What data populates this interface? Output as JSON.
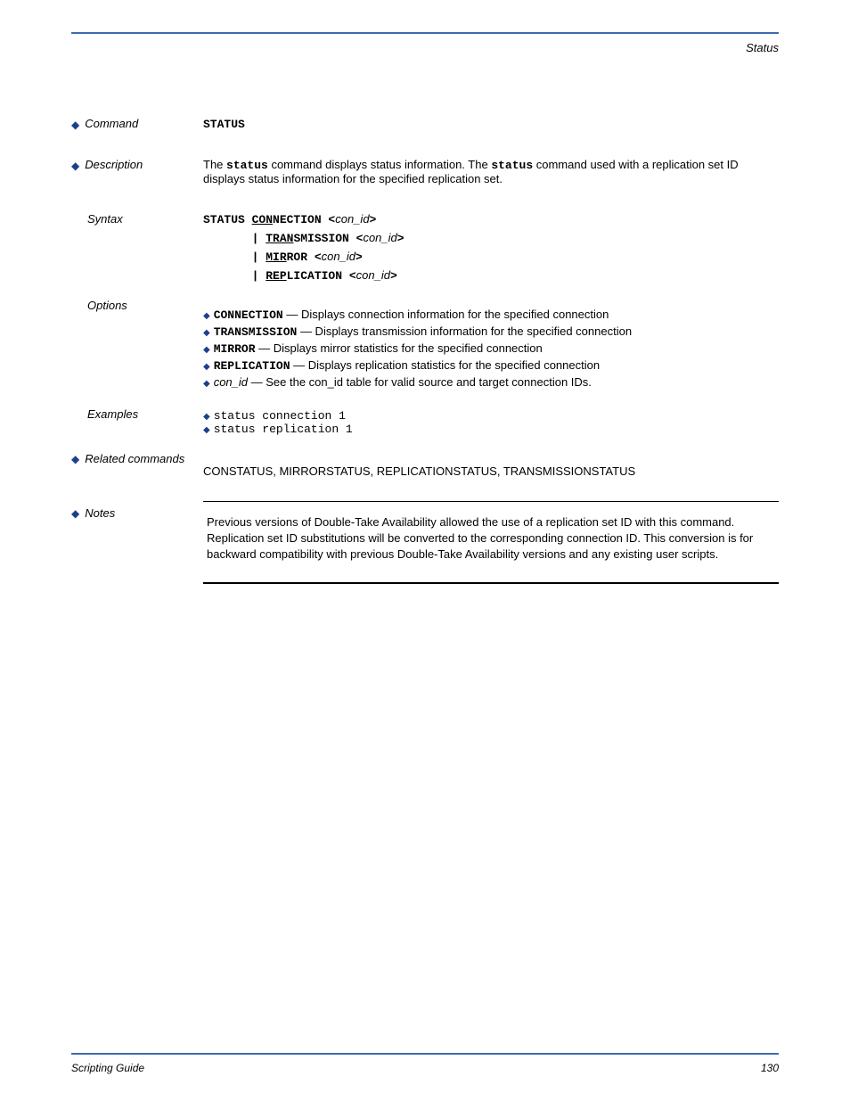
{
  "header": {
    "right": "Status"
  },
  "s_command": {
    "label": "Command",
    "text": "STATUS"
  },
  "s_desc": {
    "label": "Description",
    "before": "The ",
    "cmd": "status",
    "mid": " command displays status information. The ",
    "cmd2": "status",
    "after": " command used with a replication set ID displays status information for the specified replication set."
  },
  "s_syntax": {
    "label": "Syntax"
  },
  "syntax": {
    "l1a": "STATUS ",
    "l1b": "CON",
    "l1c": "NECTION <",
    "l1arg": "con_id",
    "l1d": ">",
    "pipe": " | ",
    "l2a": "TRAN",
    "l2b": "SMISSION <",
    "l2arg": "con_id",
    "l2c": ">",
    "l3a": "MIR",
    "l3b": "ROR <",
    "l3arg": "con_id",
    "l3c": ">",
    "l4a": "REP",
    "l4b": "LICATION <",
    "l4arg": "con_id",
    "l4c": ">"
  },
  "s_options": {
    "label": "Options"
  },
  "options": [
    {
      "kw": "CONNECTION",
      "desc": " — Displays connection information for the specified connection"
    },
    {
      "kw": "TRANSMISSION",
      "desc": " — Displays transmission information for the specified connection"
    },
    {
      "kw": "MIRROR",
      "desc": " — Displays mirror statistics for the specified connection"
    },
    {
      "kw": "REPLICATION",
      "desc": " — Displays replication statistics for the specified connection"
    }
  ],
  "conid": {
    "name": "con_id",
    "desc": " — See the con_id table for valid source and target connection IDs."
  },
  "s_examples": {
    "label": "Examples"
  },
  "examples": [
    "status connection 1",
    "status replication 1"
  ],
  "s_related": {
    "label": "Related commands",
    "text": "CONSTATUS, MIRRORSTATUS, REPLICATIONSTATUS, TRANSMISSIONSTATUS"
  },
  "s_notes": {
    "label": "Notes",
    "text": "Previous versions of Double-Take Availability allowed the use of a replication set ID with this command. Replication set ID substitutions will be converted to the corresponding connection ID. This conversion is for backward compatibility with previous Double-Take Availability versions and any existing user scripts."
  },
  "footer": {
    "left": "Scripting Guide",
    "right": "130"
  }
}
